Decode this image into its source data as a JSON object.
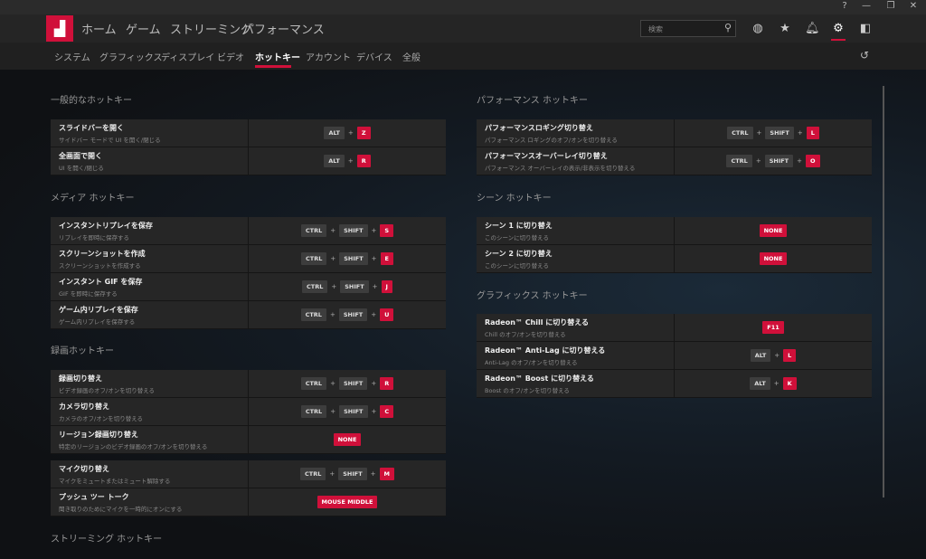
{
  "window": {
    "help": "?",
    "minimize": "—",
    "restore": "❐",
    "close": "✕"
  },
  "header": {
    "logo": "▟",
    "nav": [
      "ホーム",
      "ゲーム",
      "ストリーミング",
      "パフォーマンス"
    ],
    "search_placeholder": "検索",
    "icons": [
      "globe-icon",
      "star-icon",
      "bell-icon",
      "gear-icon",
      "sidebar-icon"
    ]
  },
  "subnav": {
    "tabs": [
      "システム",
      "グラフィックス",
      "ディスプレイ",
      "ビデオ",
      "ホットキー",
      "アカウント",
      "デバイス",
      "全般"
    ],
    "active": "ホットキー"
  },
  "accent": "#d0103a",
  "sections": [
    {
      "title": "一般的なホットキー",
      "groups": [
        [
          {
            "title": "スライドバーを開く",
            "sub": "サイドバー モードで UI を開く/閉じる",
            "keys": [
              "ALT",
              "Z"
            ]
          },
          {
            "title": "全画面で開く",
            "sub": "UI を開く/閉じる",
            "keys": [
              "ALT",
              "R"
            ]
          }
        ]
      ]
    },
    {
      "title": "メディア ホットキー",
      "groups": [
        [
          {
            "title": "インスタントリプレイを保存",
            "sub": "リプレイを即時に保存する",
            "keys": [
              "CTRL",
              "SHIFT",
              "S"
            ]
          },
          {
            "title": "スクリーンショットを作成",
            "sub": "スクリーンショットを作成する",
            "keys": [
              "CTRL",
              "SHIFT",
              "E"
            ]
          },
          {
            "title": "インスタント GIF を保存",
            "sub": "GIF を即時に保存する",
            "keys": [
              "CTRL",
              "SHIFT",
              "J"
            ]
          },
          {
            "title": "ゲーム内リプレイを保存",
            "sub": "ゲーム内リプレイを保存する",
            "keys": [
              "CTRL",
              "SHIFT",
              "U"
            ]
          }
        ]
      ]
    },
    {
      "title": "録画ホットキー",
      "groups": [
        [
          {
            "title": "録画切り替え",
            "sub": "ビデオ録画のオフ/オンを切り替える",
            "keys": [
              "CTRL",
              "SHIFT",
              "R"
            ]
          },
          {
            "title": "カメラ切り替え",
            "sub": "カメラのオフ/オンを切り替える",
            "keys": [
              "CTRL",
              "SHIFT",
              "C"
            ]
          },
          {
            "title": "リージョン録画切り替え",
            "sub": "特定のリージョンのビデオ録画のオフ/オンを切り替える",
            "keys": [
              "NONE"
            ]
          }
        ],
        [
          {
            "title": "マイク切り替え",
            "sub": "マイクをミュートまたはミュート解除する",
            "keys": [
              "CTRL",
              "SHIFT",
              "M"
            ]
          },
          {
            "title": "プッシュ ツー トーク",
            "sub": "聞き取りのためにマイクを一時的にオンにする",
            "keys": [
              "MOUSE MIDDLE"
            ]
          }
        ]
      ]
    },
    {
      "title": "ストリーミング ホットキー",
      "groups": []
    },
    {
      "title": "パフォーマンス ホットキー",
      "groups": [
        [
          {
            "title": "パフォーマンスロギング切り替え",
            "sub": "パフォーマンス ロギングのオフ/オンを切り替える",
            "keys": [
              "CTRL",
              "SHIFT",
              "L"
            ]
          },
          {
            "title": "パフォーマンスオーバーレイ切り替え",
            "sub": "パフォーマンス オーバーレイの表示/非表示を切り替える",
            "keys": [
              "CTRL",
              "SHIFT",
              "O"
            ]
          }
        ]
      ]
    },
    {
      "title": "シーン ホットキー",
      "groups": [
        [
          {
            "title": "シーン 1 に切り替え",
            "sub": "このシーンに切り替える",
            "keys": [
              "NONE"
            ]
          },
          {
            "title": "シーン 2 に切り替え",
            "sub": "このシーンに切り替える",
            "keys": [
              "NONE"
            ]
          }
        ]
      ]
    },
    {
      "title": "グラフィックス ホットキー",
      "groups": [
        [
          {
            "title": "Radeon™ Chill に切り替える",
            "sub": "Chill のオフ/オンを切り替える",
            "keys": [
              "F11"
            ]
          },
          {
            "title": "Radeon™ Anti-Lag に切り替える",
            "sub": "Anti-Lag のオフ/オンを切り替える",
            "keys": [
              "ALT",
              "L"
            ]
          },
          {
            "title": "Radeon™ Boost に切り替える",
            "sub": "Boost のオフ/オンを切り替える",
            "keys": [
              "ALT",
              "K"
            ]
          }
        ]
      ]
    }
  ]
}
